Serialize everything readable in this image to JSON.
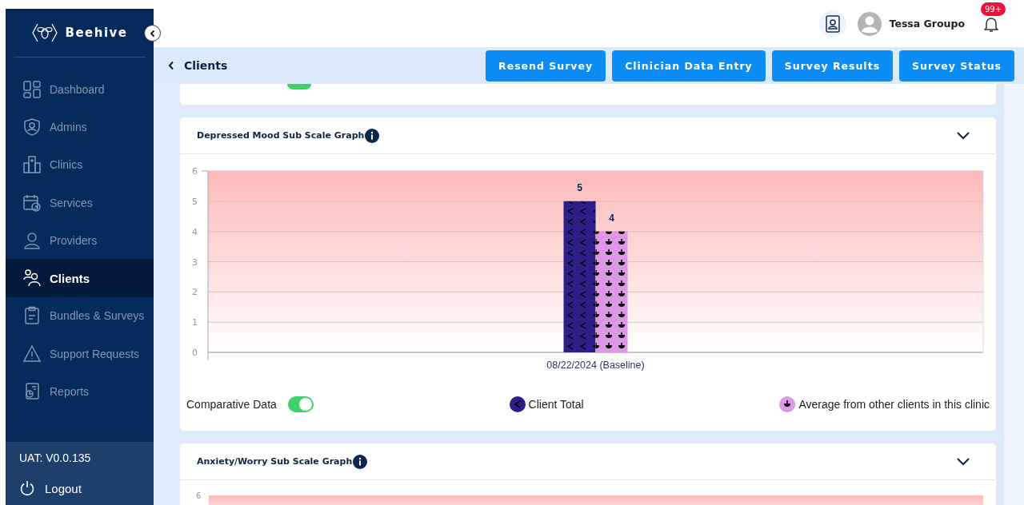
{
  "sidebar": {
    "logo": "Beehive",
    "items": [
      {
        "label": "Dashboard",
        "selected": false
      },
      {
        "label": "Admins",
        "selected": false
      },
      {
        "label": "Clinics",
        "selected": false
      },
      {
        "label": "Services",
        "selected": false
      },
      {
        "label": "Providers",
        "selected": false
      },
      {
        "label": "Clients",
        "selected": true
      },
      {
        "label": "Bundles & Surveys",
        "selected": false
      },
      {
        "label": "Support Requests",
        "selected": false
      },
      {
        "label": "Reports",
        "selected": false
      }
    ],
    "version": "UAT: V0.0.135",
    "logout": "Logout"
  },
  "header": {
    "user_name": "Tessa Groupo",
    "notification_badge": "99+"
  },
  "top_card": {
    "toggle_on": true
  },
  "subheader": {
    "back_label": "Clients",
    "buttons": [
      "Resend Survey",
      "Clinician Data Entry",
      "Survey Results",
      "Survey Status"
    ]
  },
  "cards": [
    {
      "title": "Depressed Mood Sub Scale Graph",
      "expanded": true,
      "chart_data": {
        "type": "bar",
        "categories": [
          "08/22/2024 (Baseline)"
        ],
        "series": [
          {
            "name": "Client Total",
            "color": "#2e1f86",
            "values": [
              5
            ]
          },
          {
            "name": "Average from other clients in this clinic",
            "color": "#dc98e6",
            "values": [
              4
            ]
          }
        ],
        "ylim": [
          0,
          6
        ],
        "yticks": [
          0,
          1,
          2,
          3,
          4,
          5,
          6
        ],
        "grid": true,
        "data_labels": true
      },
      "comparative_label": "Comparative Data",
      "comparative_on": true
    },
    {
      "title": "Anxiety/Worry Sub Scale Graph",
      "expanded": true,
      "top_tick": "6"
    }
  ]
}
